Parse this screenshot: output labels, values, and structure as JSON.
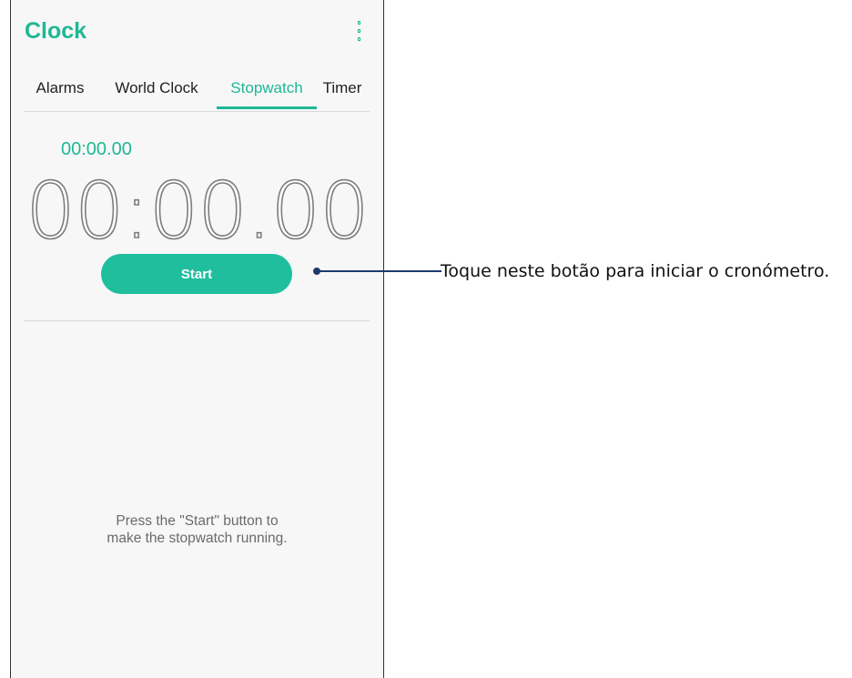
{
  "app": {
    "title": "Clock"
  },
  "tabs": [
    {
      "label": "Alarms"
    },
    {
      "label": "World Clock"
    },
    {
      "label": "Stopwatch",
      "active": true
    },
    {
      "label": "Timer"
    }
  ],
  "stopwatch": {
    "lap_time": "00:00.00",
    "main_time": "00:00.00",
    "start_label": "Start",
    "hint": "Press the \"Start\" button to make the stopwatch running."
  },
  "callout": {
    "text": "Toque neste botão para iniciar o cronómetro."
  },
  "colors": {
    "accent": "#1fb895",
    "button": "#1fbf9e",
    "callout": "#1d3a6b"
  },
  "icons": {
    "menu": "more-vert-icon"
  }
}
